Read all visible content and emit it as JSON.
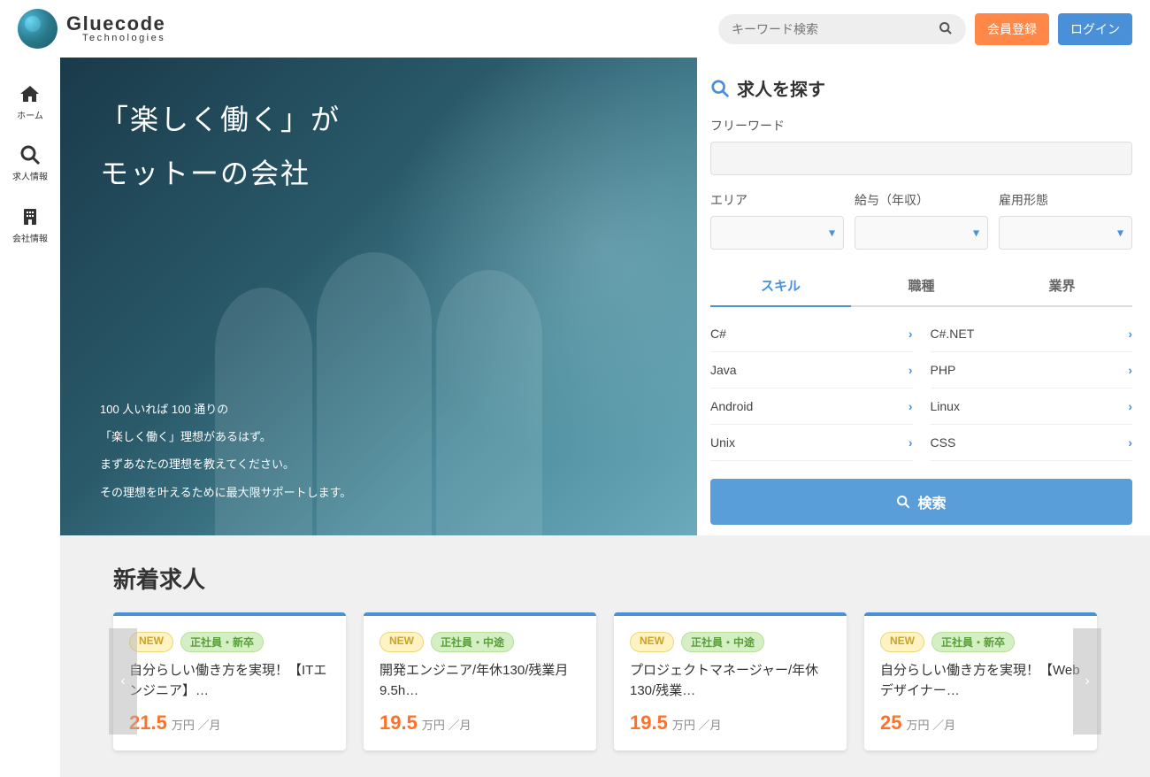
{
  "header": {
    "logo_main": "Gluecode",
    "logo_sub": "Technologies",
    "search_placeholder": "キーワード検索",
    "register_label": "会員登録",
    "login_label": "ログイン"
  },
  "sidebar": {
    "items": [
      {
        "label": "ホーム"
      },
      {
        "label": "求人情報"
      },
      {
        "label": "会社情報"
      }
    ]
  },
  "hero": {
    "title1": "「楽しく働く」が",
    "title2": "モットーの会社",
    "line1": "100 人いれば 100 通りの",
    "line2": "「楽しく働く」理想があるはず。",
    "line3": "まずあなたの理想を教えてください。",
    "line4": "その理想を叶えるために最大限サポートします。"
  },
  "search": {
    "heading": "求人を探す",
    "freeword_label": "フリーワード",
    "area_label": "エリア",
    "salary_label": "給与（年収）",
    "employment_label": "雇用形態",
    "tabs": [
      "スキル",
      "職種",
      "業界"
    ],
    "skills": [
      "C#",
      "C#.NET",
      "Java",
      "PHP",
      "Android",
      "Linux",
      "Unix",
      "CSS"
    ],
    "button_label": "検索"
  },
  "new_jobs": {
    "heading": "新着求人",
    "cards": [
      {
        "new": "NEW",
        "type": "正社員・新卒",
        "title": "自分らしい働き方を実現！【ITエンジニア】…",
        "salary_num": "21.5",
        "salary_unit": "万円 ／月"
      },
      {
        "new": "NEW",
        "type": "正社員・中途",
        "title": "開発エンジニア/年休130/残業月9.5h…",
        "salary_num": "19.5",
        "salary_unit": "万円 ／月"
      },
      {
        "new": "NEW",
        "type": "正社員・中途",
        "title": "プロジェクトマネージャー/年休130/残業…",
        "salary_num": "19.5",
        "salary_unit": "万円 ／月"
      },
      {
        "new": "NEW",
        "type": "正社員・新卒",
        "title": "自分らしい働き方を実現！【Webデザイナー…",
        "salary_num": "25",
        "salary_unit": "万円 ／月"
      }
    ]
  }
}
